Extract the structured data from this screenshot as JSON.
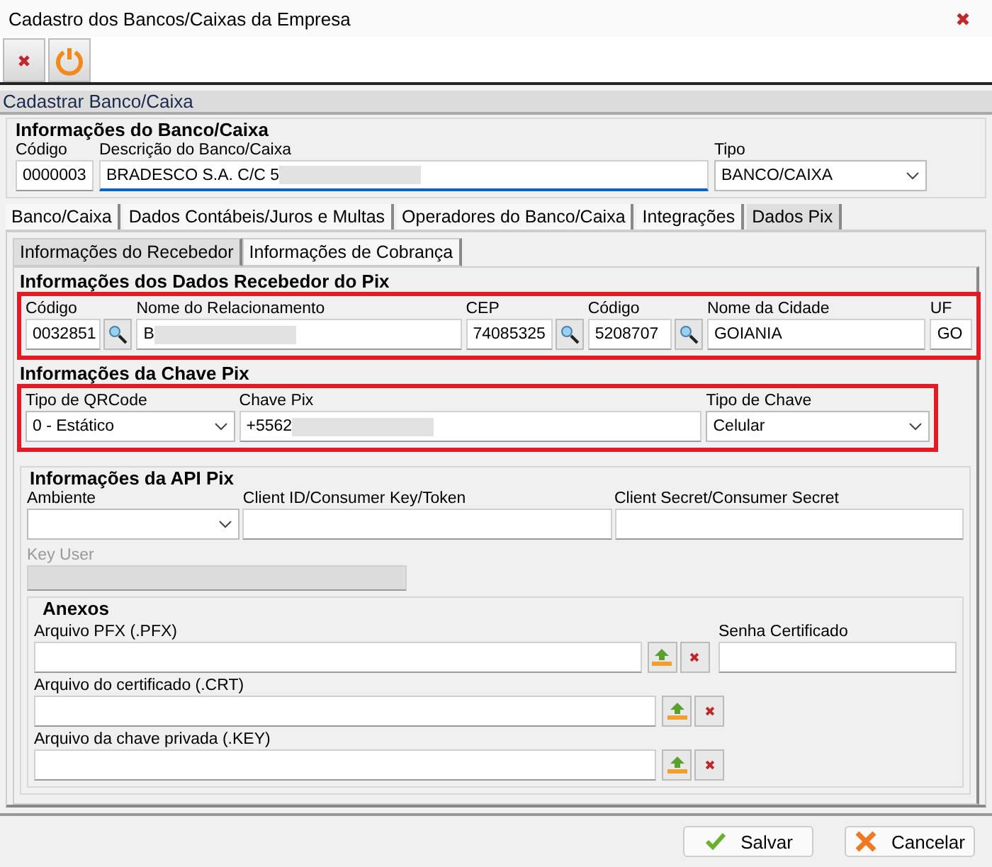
{
  "window": {
    "title": "Cadastro dos Bancos/Caixas da Empresa"
  },
  "toolbar": {
    "buttons": [
      {
        "kind": "delete"
      },
      {
        "kind": "power"
      }
    ]
  },
  "header": {
    "title": "Cadastrar Banco/Caixa"
  },
  "bank_info": {
    "title": "Informações do Banco/Caixa",
    "fields": [
      {
        "label": "Código",
        "value": "0000003",
        "kind": "text"
      },
      {
        "label": "Descrição do Banco/Caixa",
        "value": "BRADESCO S.A. C/C 5",
        "kind": "text",
        "redacted": true,
        "focused": true
      },
      {
        "label": "Tipo",
        "value": "BANCO/CAIXA",
        "kind": "select"
      }
    ]
  },
  "tabs": [
    {
      "label": "Banco/Caixa",
      "selected": false
    },
    {
      "label": "Dados Contábeis/Juros e Multas",
      "selected": false
    },
    {
      "label": "Operadores do Banco/Caixa",
      "selected": false
    },
    {
      "label": "Integrações",
      "selected": false
    },
    {
      "label": "Dados Pix",
      "selected": true
    }
  ],
  "subtabs": [
    {
      "label": "Informações do Recebedor",
      "selected": true
    },
    {
      "label": "Informações de Cobrança",
      "selected": false
    }
  ],
  "receiver": {
    "title": "Informações dos Dados Recebedor do Pix",
    "highlighted": true,
    "fields": [
      {
        "label": "Código",
        "value": "0032851",
        "kind": "lookup"
      },
      {
        "label": "Nome do Relacionamento",
        "value": "B",
        "kind": "text",
        "redacted": true
      },
      {
        "label": "CEP",
        "value": "74085325",
        "kind": "lookup"
      },
      {
        "label": "Código",
        "value": "5208707",
        "kind": "lookup"
      },
      {
        "label": "Nome da Cidade",
        "value": "GOIANIA",
        "kind": "text"
      },
      {
        "label": "UF",
        "value": "GO",
        "kind": "text"
      }
    ]
  },
  "pix_key": {
    "title": "Informações da Chave Pix",
    "highlighted": true,
    "fields": [
      {
        "label": "Tipo de QRCode",
        "value": "0 - Estático",
        "kind": "select"
      },
      {
        "label": "Chave Pix",
        "value": "+5562",
        "kind": "text",
        "redacted": true
      },
      {
        "label": "Tipo de Chave",
        "value": "Celular",
        "kind": "select"
      }
    ]
  },
  "api": {
    "title": "Informações da API Pix",
    "fields": [
      {
        "label": "Ambiente",
        "kind": "select"
      },
      {
        "label": "Client ID/Consumer Key/Token",
        "kind": "text"
      },
      {
        "label": "Client Secret/Consumer Secret",
        "kind": "text"
      }
    ],
    "key_user": {
      "label": "Key User",
      "disabled": true
    }
  },
  "attachments": {
    "title": "Anexos",
    "files": [
      {
        "label": "Arquivo PFX (.PFX)"
      },
      {
        "label": "Arquivo do certificado (.CRT)"
      },
      {
        "label": "Arquivo da chave privada (.KEY)"
      }
    ],
    "password": {
      "label": "Senha Certificado"
    }
  },
  "footer": {
    "buttons": [
      {
        "label": "Salvar",
        "kind": "save"
      },
      {
        "label": "Cancelar",
        "kind": "cancel"
      }
    ]
  }
}
